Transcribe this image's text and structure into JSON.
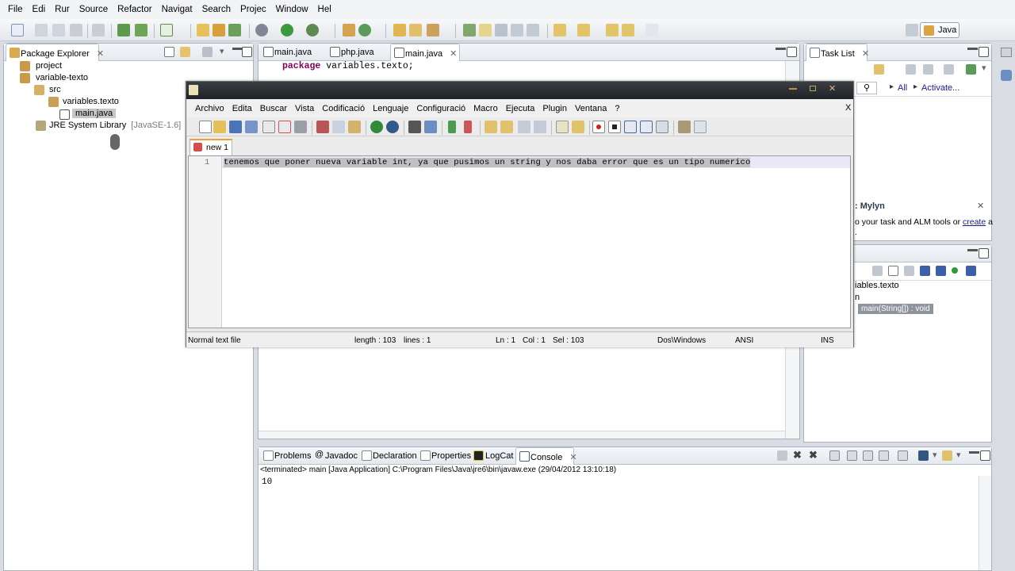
{
  "menu": [
    "File",
    "Edi",
    "Rur",
    "Source",
    "Refactor",
    "Navigat",
    "Search",
    "Projec",
    "Window",
    "Hel"
  ],
  "perspective": {
    "label": "Java"
  },
  "package_explorer": {
    "title": "Package Explorer",
    "items": [
      {
        "label": "project"
      },
      {
        "label": "variable-texto"
      },
      {
        "label": "src"
      },
      {
        "label": "variables.texto"
      },
      {
        "label": "main.java"
      },
      {
        "label": "JRE System Library",
        "suffix": "[JavaSE-1.6]"
      }
    ]
  },
  "editor": {
    "tabs": [
      "main.java",
      "php.java",
      "main.java"
    ],
    "code_keyword": "package",
    "code_rest": " variables.texto;"
  },
  "tasklist": {
    "title": "Task List",
    "filter": "All",
    "activate": "Activate...",
    "mylyn_title": ": Mylyn",
    "mylyn_text": "o your task and ALM tools or ",
    "mylyn_link": "create",
    "mylyn_text2": " a"
  },
  "outline": {
    "items": [
      "iables.texto",
      "n",
      "main(String[]) : void"
    ]
  },
  "bottom": {
    "tabs": [
      "Problems",
      "Javadoc",
      "Declaration",
      "Properties",
      "LogCat",
      "Console"
    ],
    "terminated": "<terminated> main [Java Application] C:\\Program Files\\Java\\jre6\\bin\\javaw.exe (29/04/2012 13:10:18)",
    "output": "10"
  },
  "notepad": {
    "menu": [
      "Archivo",
      "Edita",
      "Buscar",
      "Vista",
      "Codificació",
      "Lenguaje",
      "Configuració",
      "Macro",
      "Ejecuta",
      "Plugin",
      "Ventana",
      "?"
    ],
    "close": "X",
    "tab": "new  1",
    "line_number": "1",
    "line_text": "tenemos que poner nueva variable int, ya que pusimos un string y nos daba error que es un tipo numerico",
    "status": {
      "type": "Normal text file",
      "length": "length : 103",
      "lines": "lines : 1",
      "ln": "Ln : 1",
      "col": "Col : 1",
      "sel": "Sel : 103",
      "eol": "Dos\\Windows",
      "enc": "ANSI",
      "mode": "INS"
    }
  },
  "colors": {
    "accent": "#316ac5",
    "selection": "#c0c0c0"
  }
}
